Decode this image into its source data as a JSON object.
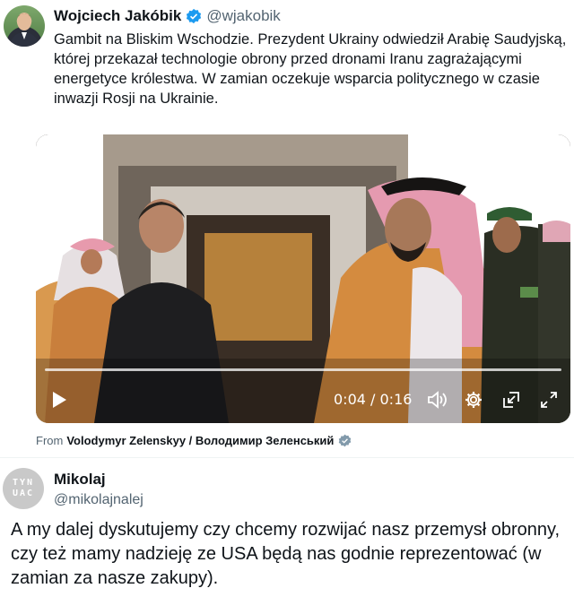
{
  "post": {
    "author_name": "Wojciech Jakóbik",
    "author_handle": "@wjakobik",
    "text": "Gambit na Bliskim Wschodzie. Prezydent Ukrainy odwiedził Arabię Saudyjską, której przekazał technologie obrony przed dronami Iranu zagrażającymi energetyce królestwa. W zamian oczekuje wsparcia politycznego w czasie inwazji Rosji na Ukrainie.",
    "video": {
      "time_current": "0:04",
      "time_separator": " / ",
      "time_total": "0:16",
      "progress": 0.0,
      "icons": [
        "play-icon",
        "volume-icon",
        "settings-icon",
        "pip-icon",
        "fullscreen-icon"
      ]
    },
    "from_prefix": "From",
    "from_source": "Volodymyr Zelenskyy / Володимир Зеленський",
    "verified_color": "#1d9bf0",
    "source_badge_color": "#829aab"
  },
  "reply": {
    "author_name": "Mikolaj",
    "author_handle": "@mikolajnalej",
    "avatar_text": "TYN UAC",
    "text": "A my dalej dyskutujemy czy chcemy rozwijać nasz przemysł obronny, czy też mamy nadzieję ze USA będą nas godnie reprezentować (w zamian za nasze zakupy)."
  }
}
